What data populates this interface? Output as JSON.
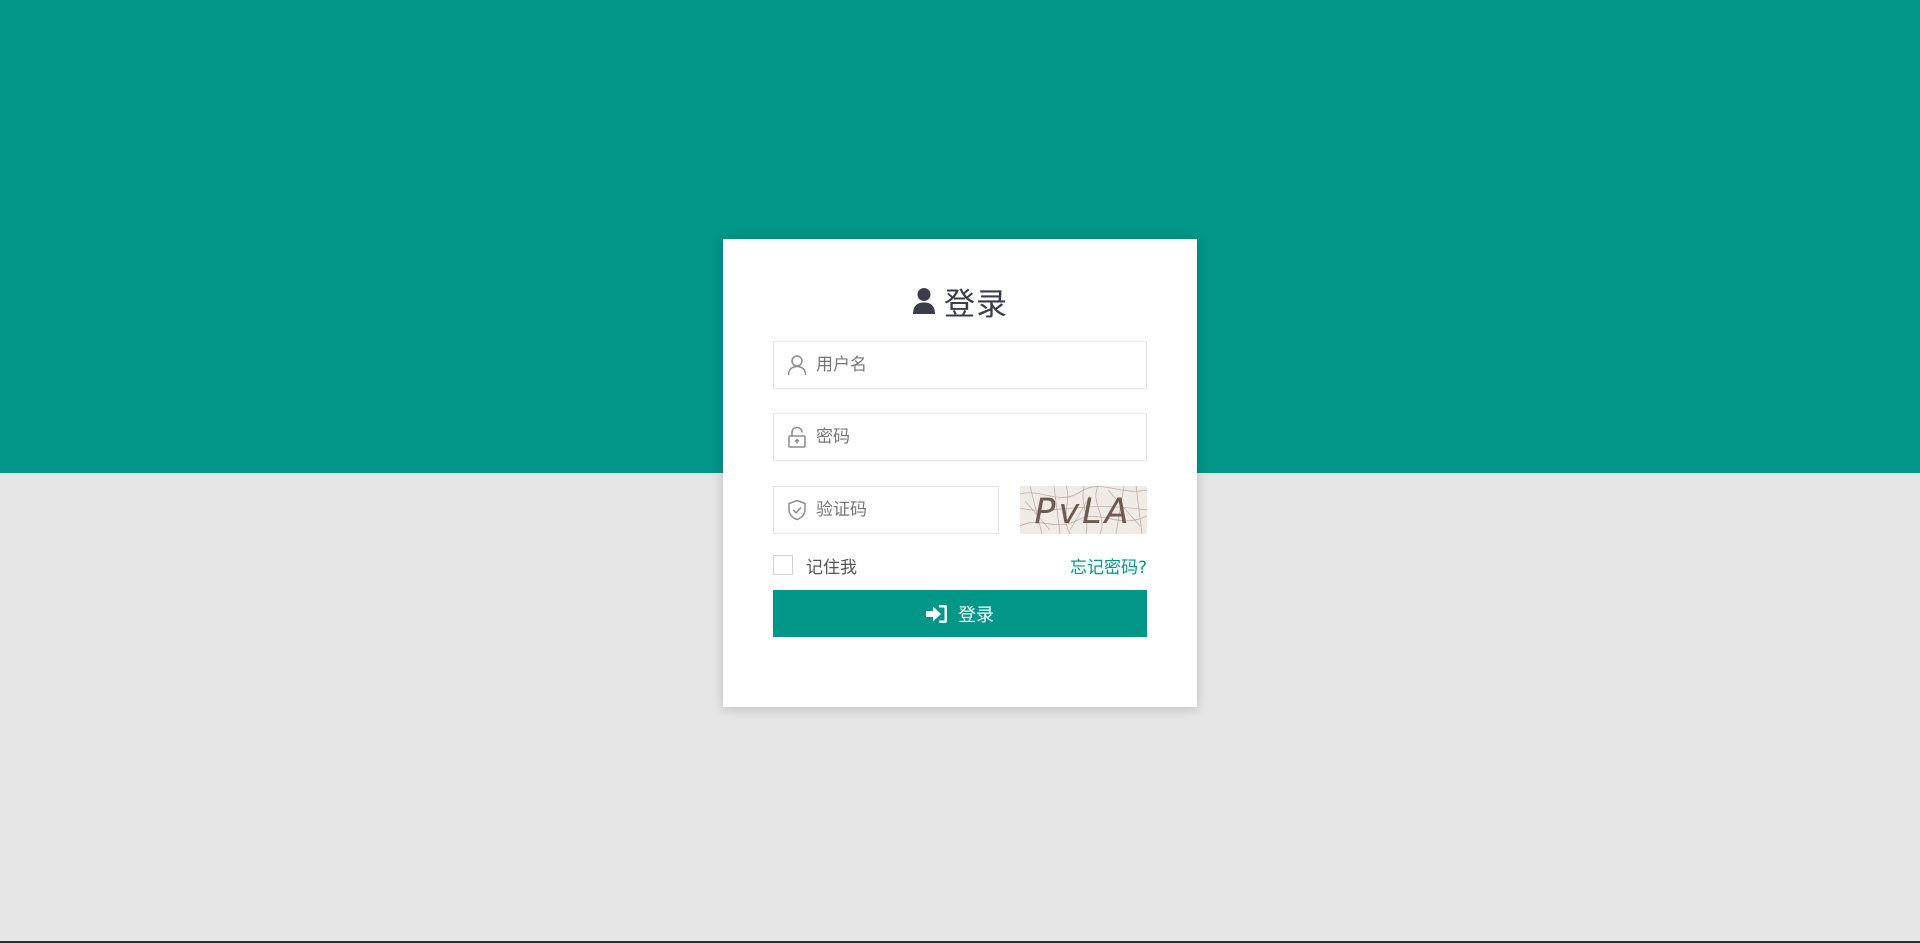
{
  "colors": {
    "primary": "#009688",
    "page_background": "#e6e6e6",
    "card_background": "#ffffff",
    "title_text": "#393d49"
  },
  "login": {
    "title": "登录",
    "title_icon": "user-icon",
    "username": {
      "placeholder": "用户名",
      "value": "",
      "icon": "user-outline-icon"
    },
    "password": {
      "placeholder": "密码",
      "value": "",
      "icon": "unlock-icon"
    },
    "captcha": {
      "placeholder": "验证码",
      "value": "",
      "icon": "shield-check-icon",
      "image_text": "PvLA"
    },
    "remember_me": {
      "label": "记住我",
      "checked": false
    },
    "forgot_password": "忘记密码?",
    "submit": {
      "label": "登录",
      "icon": "sign-in-icon"
    }
  }
}
